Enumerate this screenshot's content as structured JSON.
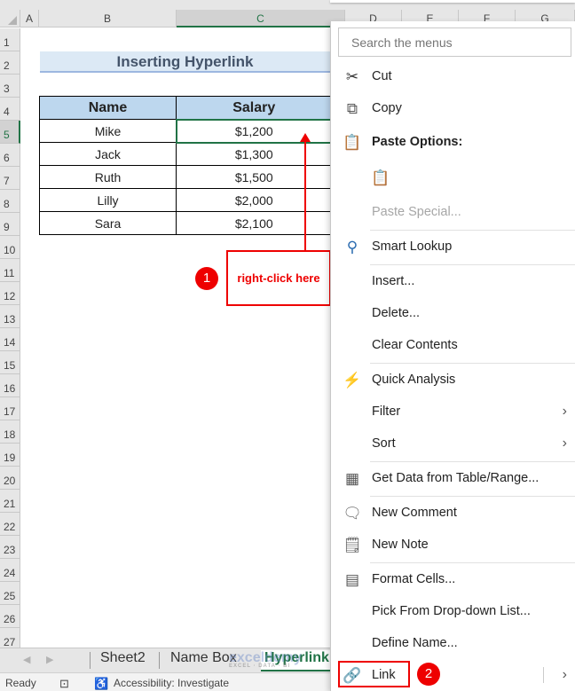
{
  "spreadsheet": {
    "columns": [
      "A",
      "B",
      "C",
      "D",
      "E",
      "F",
      "G"
    ],
    "selected_column": "C",
    "rows": [
      "1",
      "2",
      "3",
      "4",
      "5",
      "6",
      "7",
      "8",
      "9",
      "10",
      "11",
      "12",
      "13",
      "14",
      "15",
      "16",
      "17",
      "18",
      "19",
      "20",
      "21",
      "22",
      "23",
      "24",
      "25",
      "26",
      "27"
    ],
    "selected_row": "5",
    "title": "Inserting Hyperlink",
    "table": {
      "headers": [
        "Name",
        "Salary"
      ],
      "rows": [
        [
          "Mike",
          "$1,200"
        ],
        [
          "Jack",
          "$1,300"
        ],
        [
          "Ruth",
          "$1,500"
        ],
        [
          "Lilly",
          "$2,000"
        ],
        [
          "Sara",
          "$2,100"
        ]
      ]
    }
  },
  "annotations": {
    "callout_text": "right-click here",
    "step1": "1",
    "step2": "2",
    "annotation_color": "#ee0000"
  },
  "sheet_tabs": {
    "tabs": [
      "Sheet2",
      "Name Box",
      "Hyperlink"
    ],
    "active": "Hyperlink",
    "watermark": "exceldemy",
    "watermark_sub": "EXCEL · DATA · BI"
  },
  "status_bar": {
    "ready": "Ready",
    "accessibility": "Accessibility: Investigate"
  },
  "context_menu": {
    "search_placeholder": "Search the menus",
    "items": {
      "cut": "Cut",
      "copy": "Copy",
      "paste_options": "Paste Options:",
      "paste_special": "Paste Special...",
      "smart_lookup": "Smart Lookup",
      "insert": "Insert...",
      "delete": "Delete...",
      "clear_contents": "Clear Contents",
      "quick_analysis": "Quick Analysis",
      "filter": "Filter",
      "sort": "Sort",
      "get_data": "Get Data from Table/Range...",
      "new_comment": "New Comment",
      "new_note": "New Note",
      "format_cells": "Format Cells...",
      "pick_from_list": "Pick From Drop-down List...",
      "define_name": "Define Name...",
      "link": "Link"
    }
  },
  "colors": {
    "excel_green": "#217346",
    "header_blue": "#bdd7ee",
    "title_bg": "#dce9f5",
    "title_text": "#44546a"
  }
}
